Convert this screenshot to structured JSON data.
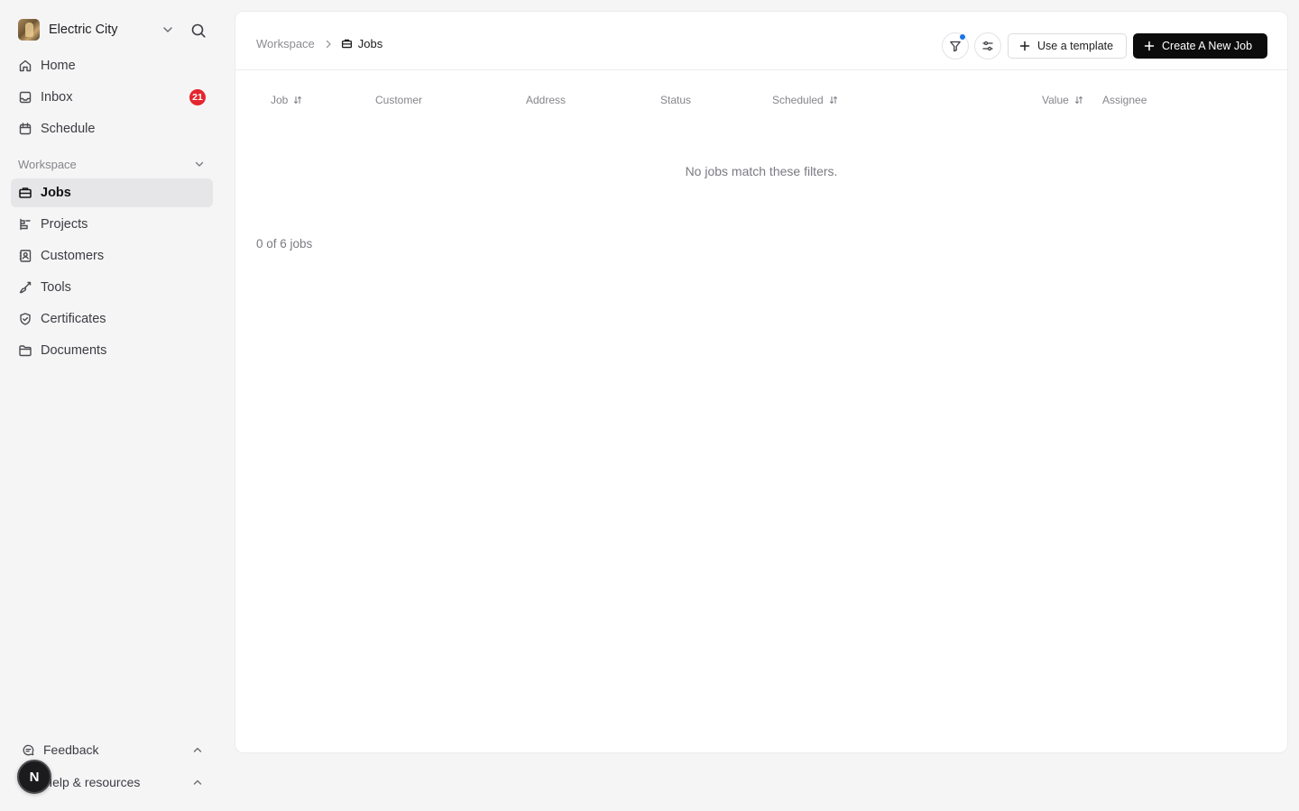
{
  "workspace": {
    "name": "Electric City"
  },
  "nav": {
    "home": "Home",
    "inbox": "Inbox",
    "inbox_badge": "21",
    "schedule": "Schedule",
    "section": "Workspace",
    "jobs": "Jobs",
    "projects": "Projects",
    "customers": "Customers",
    "tools": "Tools",
    "certificates": "Certificates",
    "documents": "Documents"
  },
  "footer": {
    "feedback": "Feedback",
    "help": "Help & resources",
    "user_initial": "N"
  },
  "breadcrumb": {
    "parent": "Workspace",
    "current": "Jobs"
  },
  "toolbar": {
    "template_label": "Use a template",
    "create_label": "Create A New Job"
  },
  "table": {
    "columns": [
      "Job",
      "Customer",
      "Address",
      "Status",
      "Scheduled",
      "Value",
      "Assignee"
    ],
    "empty_message": "No jobs match these filters.",
    "count_text": "0 of 6 jobs"
  },
  "colors": {
    "accent": "#1b74e4",
    "badge": "#e5262d",
    "primary_button": "#0c0c0d"
  }
}
